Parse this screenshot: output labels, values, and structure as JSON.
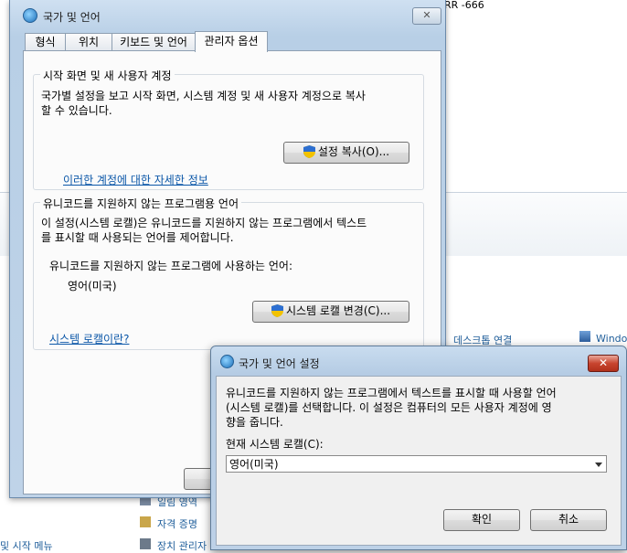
{
  "background": {
    "err_text": "RR -666",
    "right_links": [
      "데스크톱 연결",
      "Windo"
    ],
    "bottom_links": [
      "일림 영역",
      "자격 증명",
      "장치 관리자"
    ],
    "left_fragment": "및 시작 메뉴"
  },
  "main_dialog": {
    "title": "국가 및 언어",
    "close": "✕",
    "tabs": [
      "형식",
      "위치",
      "키보드 및 언어",
      "관리자 옵션"
    ],
    "group1": {
      "title": "시작 화면 및 새 사용자 계정",
      "line1": "국가별 설정을 보고 시작 화면, 시스템 계정 및 새 사용자 계정으로 복사",
      "line2": "할 수 있습니다.",
      "button": "설정 복사(O)...",
      "link": "이러한 계정에 대한 자세한 정보"
    },
    "group2": {
      "title": "유니코드를 지원하지 않는 프로그램용 언어",
      "line1": "이 설정(시스템 로캘)은 유니코드를 지원하지 않는 프로그램에서 텍스트",
      "line2": "를 표시할 때 사용되는 언어를 제어합니다.",
      "current_label": "유니코드를 지원하지 않는 프로그램에 사용하는 언어:",
      "current_value": "영어(미국)",
      "button": "시스템 로캘 변경(C)...",
      "link": "시스템 로캘이란?"
    }
  },
  "locale_dialog": {
    "title": "국가 및 언어 설정",
    "close": "✕",
    "line1": "유니코드를 지원하지 않는 프로그램에서 텍스트를 표시할 때 사용할 언어",
    "line2": "(시스템 로캘)를 선택합니다. 이 설정은 컴퓨터의 모든 사용자 계정에 영",
    "line3": "향을 줍니다.",
    "select_label": "현재 시스템 로캘(C):",
    "selected": "영어(미국)",
    "ok": "확인",
    "cancel": "취소"
  },
  "colors": {
    "link": "#0b57a8",
    "title_bar": "#bfd3e8",
    "close_red": "#c8452f"
  },
  "icons": [
    "globe-icon",
    "shield-icon",
    "dropdown-arrow-icon",
    "close-icon"
  ]
}
